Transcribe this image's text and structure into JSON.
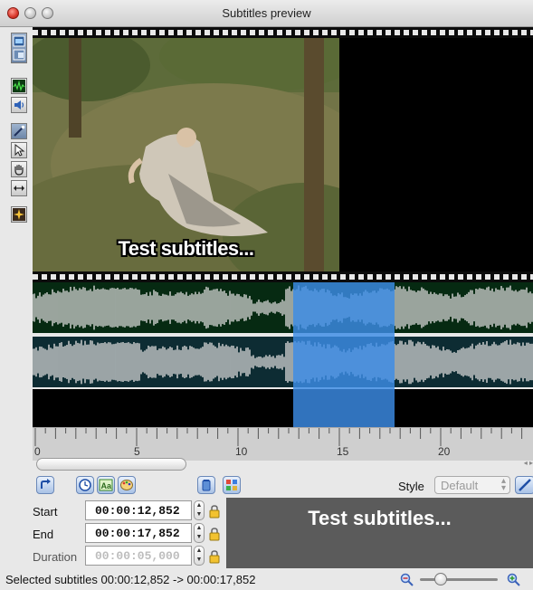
{
  "window": {
    "title": "Subtitles preview"
  },
  "toolbar": {
    "icons": [
      "video-mode-icon",
      "audio-waveform-icon",
      "speaker-icon",
      "magic-wand-icon",
      "arrow-pointer-icon",
      "hand-icon",
      "resize-arrows-icon",
      "sparkle-icon"
    ]
  },
  "video": {
    "subtitle_overlay": "Test subtitles..."
  },
  "timeline": {
    "ticks": [
      "0",
      "5",
      "10",
      "15",
      "20"
    ],
    "selection_start_seconds": 12.852,
    "selection_end_seconds": 17.852,
    "waveform_color": "#d9d9d9",
    "waveform_bg_track1": "#062a12",
    "waveform_bg_track2": "#0d2c33",
    "selection_color": "#2f7fd3"
  },
  "controls": {
    "style_label": "Style",
    "style_value": "Default"
  },
  "fields": {
    "start_label": "Start",
    "start_value": "00:00:12,852",
    "end_label": "End",
    "end_value": "00:00:17,852",
    "duration_label": "Duration",
    "duration_value": "00:00:05,000"
  },
  "preview": {
    "text": "Test subtitles..."
  },
  "status": {
    "text": "Selected subtitles 00:00:12,852 -> 00:00:17,852"
  }
}
